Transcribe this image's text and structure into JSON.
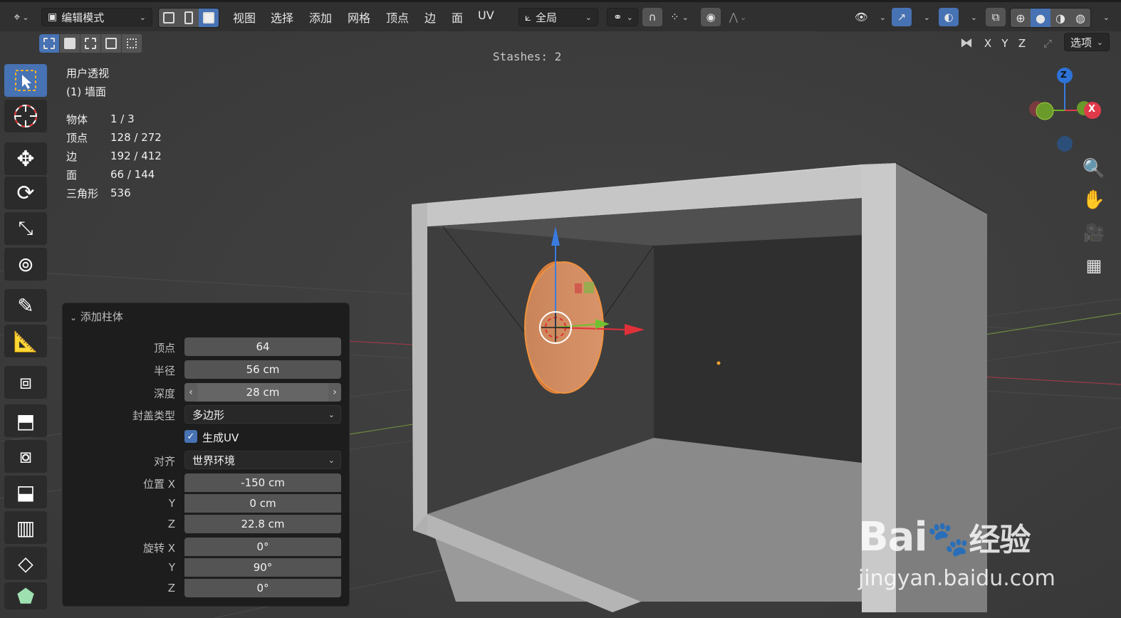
{
  "header": {
    "mode": "编辑模式",
    "menus": [
      "视图",
      "选择",
      "添加",
      "网格",
      "顶点",
      "边",
      "面",
      "UV"
    ],
    "transform_orientation": "全局",
    "axis_labels": [
      "X",
      "Y",
      "Z"
    ],
    "options_label": "选项"
  },
  "viewport": {
    "stashes": "Stashes: 2",
    "view_name": "用户透视",
    "object_name": "(1) 墙面",
    "stats": [
      {
        "key": "物体",
        "value": "1 / 3"
      },
      {
        "key": "顶点",
        "value": "128 / 272"
      },
      {
        "key": "边",
        "value": "192 / 412"
      },
      {
        "key": "面",
        "value": "66 / 144"
      },
      {
        "key": "三角形",
        "value": "536"
      }
    ],
    "gizmo": {
      "z": "Z",
      "x": "X"
    }
  },
  "panel": {
    "title": "添加柱体",
    "vertices": {
      "label": "顶点",
      "value": "64"
    },
    "radius": {
      "label": "半径",
      "value": "56 cm"
    },
    "depth": {
      "label": "深度",
      "value": "28 cm"
    },
    "cap_type": {
      "label": "封盖类型",
      "value": "多边形"
    },
    "generate_uv": {
      "label": "生成UV",
      "checked": true
    },
    "align": {
      "label": "对齐",
      "value": "世界环境"
    },
    "location": {
      "label": "位置 X",
      "x": "-150 cm",
      "y_label": "Y",
      "y": "0 cm",
      "z_label": "Z",
      "z": "22.8 cm"
    },
    "rotation": {
      "label": "旋转 X",
      "x": "0°",
      "y_label": "Y",
      "y": "90°",
      "z_label": "Z",
      "z": "0°"
    }
  },
  "watermark": {
    "brand": "Bai",
    "brand_suffix": "经验",
    "url": "jingyan.baidu.com"
  },
  "colors": {
    "accent": "#4772b3",
    "header": "#303030",
    "viewport": "#3d3d3d",
    "panel": "#1d1d1d",
    "selection": "#e8843a"
  }
}
